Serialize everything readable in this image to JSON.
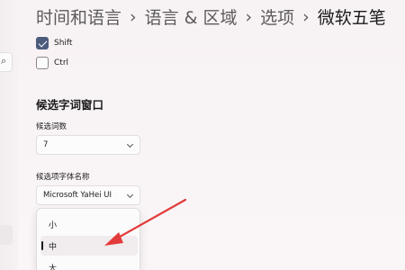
{
  "breadcrumb": {
    "items": [
      "时间和语言",
      "语言 & 区域",
      "选项",
      "微软五笔"
    ],
    "separator": "›"
  },
  "search": {
    "icon": "search-icon"
  },
  "checkboxes": [
    {
      "label": "Shift",
      "checked": true
    },
    {
      "label": "Ctrl",
      "checked": false
    }
  ],
  "candidate_window": {
    "title": "候选字词窗口",
    "count_label": "候选词数",
    "count_value": "7",
    "font_label": "候选项字体名称",
    "font_value": "Microsoft YaHei UI",
    "size_options": [
      "小",
      "中",
      "大"
    ],
    "selected_size": "中"
  },
  "colors": {
    "accent": "#4d5b7c",
    "annotation_arrow": "#e23b3b"
  }
}
